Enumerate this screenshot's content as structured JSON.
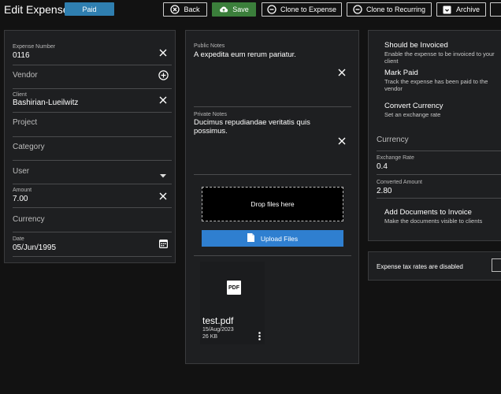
{
  "header": {
    "title": "Edit Expense",
    "status_badge": "Paid",
    "buttons": {
      "back": "Back",
      "save": "Save",
      "clone_expense": "Clone to Expense",
      "clone_recurring": "Clone to Recurring",
      "archive": "Archive"
    }
  },
  "details": {
    "expense_number": {
      "label": "Expense Number",
      "value": "0116"
    },
    "vendor": {
      "placeholder": "Vendor"
    },
    "client": {
      "label": "Client",
      "value": "Bashirian-Lueilwitz"
    },
    "project": {
      "placeholder": "Project"
    },
    "category": {
      "placeholder": "Category"
    },
    "user": {
      "placeholder": "User"
    },
    "amount": {
      "label": "Amount",
      "value": "7.00"
    },
    "currency": {
      "placeholder": "Currency"
    },
    "date": {
      "label": "Date",
      "value": "05/Jun/1995"
    }
  },
  "notes": {
    "public_label": "Public Notes",
    "public_value": "A expedita eum rerum pariatur.",
    "private_label": "Private Notes",
    "private_value": "Ducimus repudiandae veritatis quis possimus."
  },
  "documents": {
    "dropzone": "Drop files here",
    "upload_button": "Upload Files",
    "file": {
      "icon_label": "PDF",
      "name": "test.pdf",
      "date": "15/Aug/2023",
      "size": "26 KB"
    }
  },
  "settings": {
    "should_be_invoiced": {
      "title": "Should be Invoiced",
      "desc": "Enable the expense to be invoiced to your client"
    },
    "mark_paid": {
      "title": "Mark Paid",
      "desc": "Track the expense has been paid to the vendor"
    },
    "convert_currency": {
      "title": "Convert Currency",
      "desc": "Set an exchange rate"
    },
    "currency": {
      "placeholder": "Currency"
    },
    "exchange_rate": {
      "label": "Exchange Rate",
      "value": "0.4"
    },
    "converted_amount": {
      "label": "Converted Amount",
      "value": "2.80"
    },
    "add_documents": {
      "title": "Add Documents to Invoice",
      "desc": "Make the documents visible to clients"
    }
  },
  "tax": {
    "text": "Expense tax rates are disabled"
  },
  "colors": {
    "background": "#121212",
    "card": "#1e1f21",
    "badge": "#2f7fb0",
    "save": "#3b7f3b",
    "upload": "#2f7fd0"
  }
}
